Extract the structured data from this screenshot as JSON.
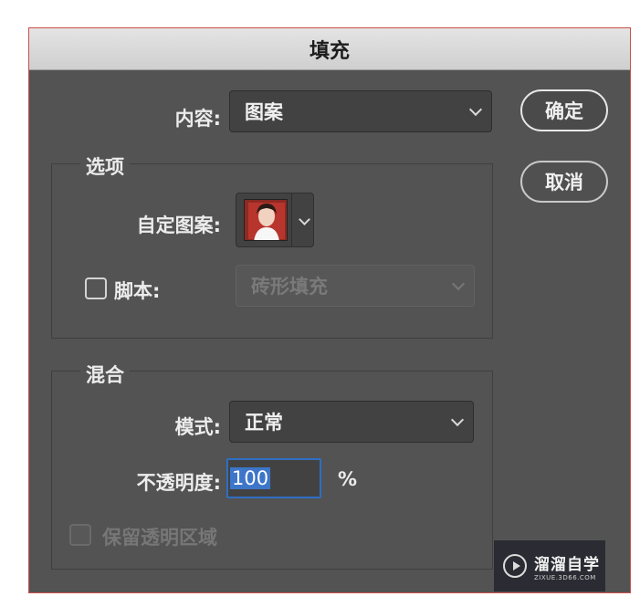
{
  "dialog": {
    "title": "填充",
    "content_label": "内容:",
    "content_value": "图案",
    "options_group": {
      "title": "选项",
      "custom_pattern_label": "自定图案:",
      "script_label": "脚本:",
      "script_checked": false,
      "script_value": "砖形填充"
    },
    "blend_group": {
      "title": "混合",
      "mode_label": "模式:",
      "mode_value": "正常",
      "opacity_label": "不透明度:",
      "opacity_value": "100",
      "opacity_unit": "%",
      "preserve_label": "保留透明区域",
      "preserve_checked": false
    },
    "buttons": {
      "ok": "确定",
      "cancel": "取消"
    }
  },
  "watermark": {
    "name": "溜溜自学",
    "url": "ZIXUE.3D66.COM"
  },
  "colors": {
    "dialog_bg": "#535353",
    "focus": "#2f6fc4",
    "titlebar": "#d8d8d8"
  }
}
